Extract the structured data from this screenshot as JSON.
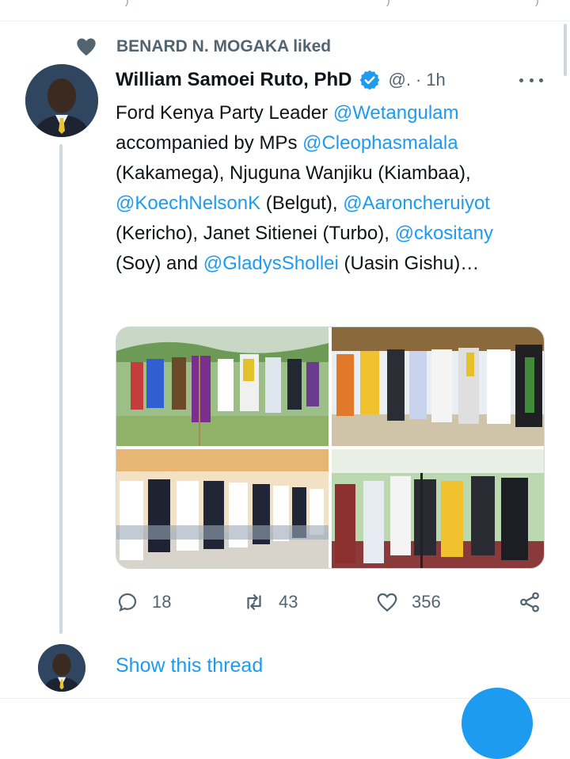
{
  "social_context": {
    "text": "BENARD N. MOGAKA liked",
    "icon": "heart-filled-icon"
  },
  "tweet": {
    "author_name": "William Samoei Ruto, PhD",
    "verified": true,
    "handle": "@.",
    "separator": "·",
    "time": "1h",
    "text_segments": [
      {
        "type": "text",
        "value": "Ford Kenya Party Leader "
      },
      {
        "type": "mention",
        "value": "@Wetangulam"
      },
      {
        "type": "text",
        "value": " accompanied by MPs "
      },
      {
        "type": "mention",
        "value": "@Cleophasmalala"
      },
      {
        "type": "text",
        "value": " (Kakamega), Njuguna Wanjiku (Kiambaa), "
      },
      {
        "type": "mention",
        "value": "@KoechNelsonK"
      },
      {
        "type": "text",
        "value": " (Belgut), "
      },
      {
        "type": "mention",
        "value": "@Aaroncheruiyot"
      },
      {
        "type": "text",
        "value": " (Kericho), Janet Sitienei (Turbo), "
      },
      {
        "type": "mention",
        "value": "@ckositany"
      },
      {
        "type": "text",
        "value": " (Soy) and "
      },
      {
        "type": "mention",
        "value": "@GladysShollei"
      },
      {
        "type": "text",
        "value": " (Uasin Gishu)…"
      }
    ],
    "media_count": 4,
    "actions": {
      "replies": "18",
      "retweets": "43",
      "likes": "356"
    }
  },
  "show_thread_label": "Show this thread",
  "colors": {
    "link_blue": "#1d9bf0",
    "muted_text": "#536471",
    "primary_text": "#0f1419",
    "line": "#cfd9de"
  }
}
